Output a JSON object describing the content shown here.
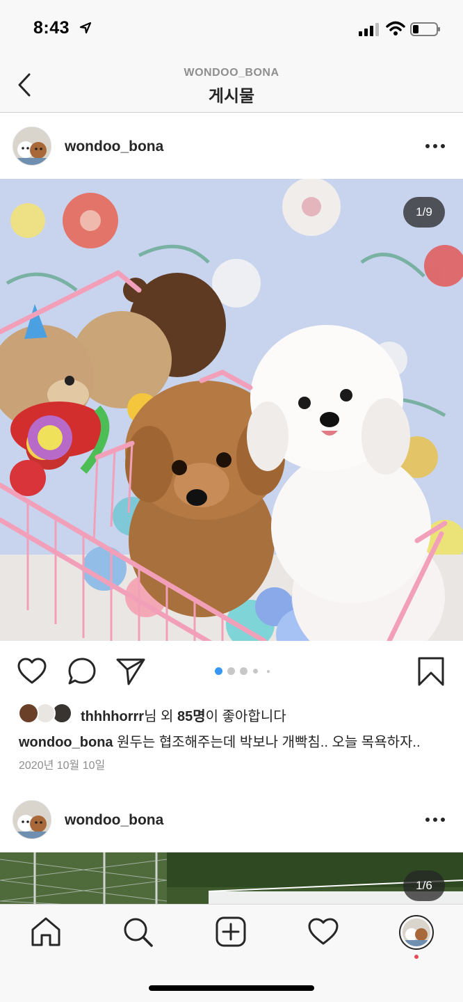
{
  "status_bar": {
    "time": "8:43"
  },
  "header": {
    "account": "WONDOO_BONA",
    "title": "게시물"
  },
  "posts": [
    {
      "username": "wondoo_bona",
      "photo_counter": "1/9",
      "carousel": {
        "total_dots": 5,
        "active_index": 0
      },
      "likes": {
        "user": "thhhhorrr",
        "suffix_1": "님 외 ",
        "count": "85명",
        "suffix_2": "이 좋아합니다"
      },
      "caption": {
        "username": "wondoo_bona",
        "text": " 원두는 협조해주는데 박보나 개빡침.. 오늘 목욕하자.."
      },
      "date": "2020년 10월 10일"
    },
    {
      "username": "wondoo_bona",
      "photo_counter": "1/6"
    }
  ],
  "icons": {
    "back": "chevron-left-icon",
    "more": "more-horizontal-icon",
    "like": "heart-icon",
    "comment": "comment-icon",
    "share": "paper-plane-icon",
    "save": "bookmark-icon",
    "tabs": [
      "home-icon",
      "search-icon",
      "add-post-icon",
      "activity-heart-icon",
      "profile-avatar"
    ]
  },
  "colors": {
    "active_dot": "#3897f0",
    "inactive_dot": "#c7c7c7",
    "notification": "#ed4956"
  }
}
